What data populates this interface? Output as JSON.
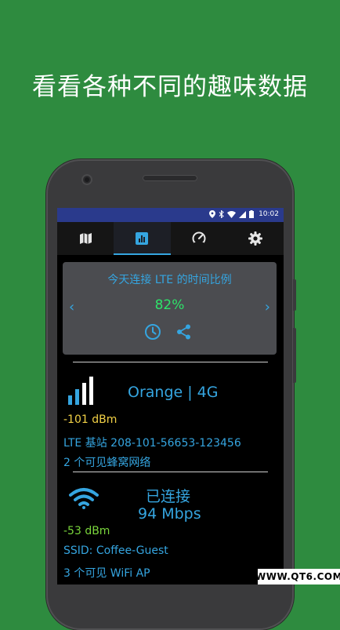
{
  "promo": {
    "headline": "看看各种不同的趣味数据"
  },
  "status_bar": {
    "time": "10:02"
  },
  "tabs": [
    {
      "icon": "map-icon",
      "active": false
    },
    {
      "icon": "stats-icon",
      "active": true
    },
    {
      "icon": "speedometer-icon",
      "active": false
    },
    {
      "icon": "gear-icon",
      "active": false
    }
  ],
  "lte_card": {
    "title": "今天连接 LTE 的时间比例",
    "value": "82%",
    "prev_arrow": "‹",
    "next_arrow": "›"
  },
  "cellular": {
    "operator": "Orange | 4G",
    "signal": "-101 dBm",
    "base_station": "LTE 基站 208-101-56653-123456",
    "visible_networks": "2 个可见蜂窝网络"
  },
  "wifi": {
    "status": "已连接",
    "speed": "94 Mbps",
    "signal": "-53 dBm",
    "ssid": "SSID: Coffee-Guest",
    "visible_aps": "3 个可见 WiFi AP"
  },
  "watermark": {
    "text": "WWW.QT6.COM"
  },
  "colors": {
    "accent": "#35a5e0",
    "status_bar": "#2a3a8c",
    "background": "#2e8b3f",
    "good": "#2ee36a"
  }
}
